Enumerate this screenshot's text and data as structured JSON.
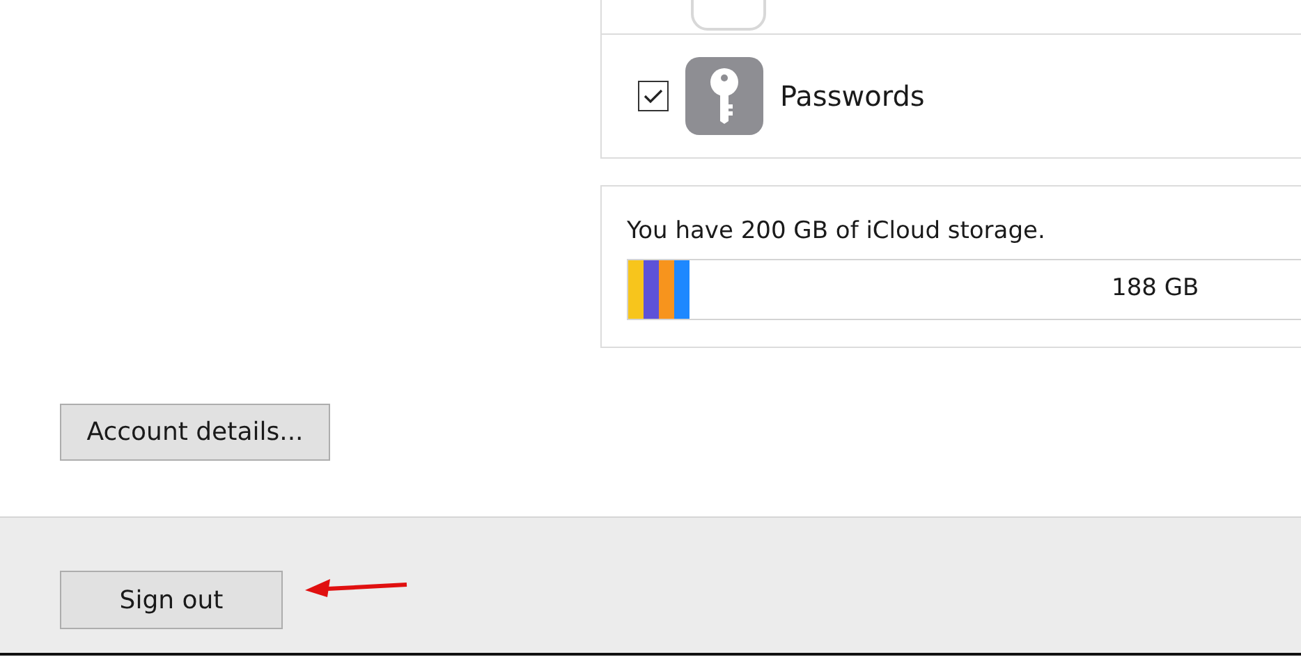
{
  "services": [
    {
      "label": "Passwords",
      "checked": true
    }
  ],
  "storage": {
    "summary": "You have 200 GB of iCloud storage.",
    "free": "188 GB",
    "level": 0.084,
    "segments": [
      {
        "color": "#f7c51c"
      },
      {
        "color": "#5d52d8"
      },
      {
        "color": "#f7941d"
      },
      {
        "color": "#1e88ff"
      }
    ]
  },
  "buttons": {
    "account_details": "Account details...",
    "sign_out": "Sign out"
  }
}
